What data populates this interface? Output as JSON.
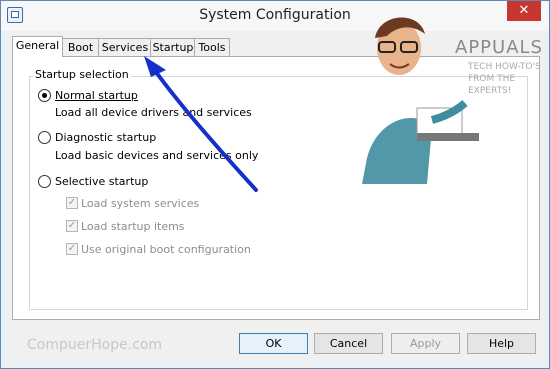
{
  "window": {
    "title": "System Configuration",
    "close_glyph": "✕"
  },
  "tabs": [
    {
      "label": "General",
      "active": true
    },
    {
      "label": "Boot",
      "active": false
    },
    {
      "label": "Services",
      "active": false
    },
    {
      "label": "Startup",
      "active": false
    },
    {
      "label": "Tools",
      "active": false
    }
  ],
  "startup": {
    "group_label": "Startup selection",
    "normal": {
      "label": "Normal startup",
      "desc": "Load all device drivers and services",
      "checked": true
    },
    "diagnostic": {
      "label": "Diagnostic startup",
      "desc": "Load basic devices and services only",
      "checked": false
    },
    "selective": {
      "label": "Selective startup",
      "checked": false,
      "options": [
        {
          "label": "Load system services",
          "checked": true
        },
        {
          "label": "Load startup items",
          "checked": true
        },
        {
          "label": "Use original boot configuration",
          "checked": true
        }
      ]
    }
  },
  "buttons": {
    "ok": "OK",
    "cancel": "Cancel",
    "apply": "Apply",
    "help": "Help"
  },
  "watermark": "CompuerHope.com",
  "logo": {
    "title": "APPUALS",
    "subtitle": "TECH HOW-TO'S FROM THE EXPERTS!"
  },
  "colors": {
    "arrow": "#1530c8",
    "close_button": "#c7372f",
    "frame": "#5a8bb8"
  }
}
